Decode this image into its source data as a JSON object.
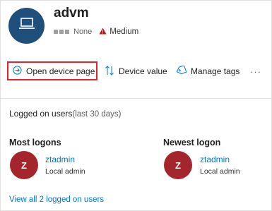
{
  "device": {
    "name": "advm",
    "health_label": "None",
    "risk_label": "Medium",
    "avatar_color": "#1f4f7a",
    "risk_color": "#c50f1f",
    "icon": "laptop-icon"
  },
  "actions": {
    "open_device_page": "Open device page",
    "device_value": "Device value",
    "manage_tags": "Manage tags",
    "more": "···"
  },
  "logged_on": {
    "title": "Logged on users",
    "period": "(last 30 days)",
    "most_logons": {
      "heading": "Most logons",
      "initial": "Z",
      "user": "ztadmin",
      "role": "Local admin"
    },
    "newest_logon": {
      "heading": "Newest logon",
      "initial": "Z",
      "user": "ztadmin",
      "role": "Local admin"
    },
    "view_all": "View all 2 logged on users"
  },
  "colors": {
    "link": "#0078d4",
    "user_avatar": "#a4262c",
    "highlight_box": "#e3222b"
  }
}
